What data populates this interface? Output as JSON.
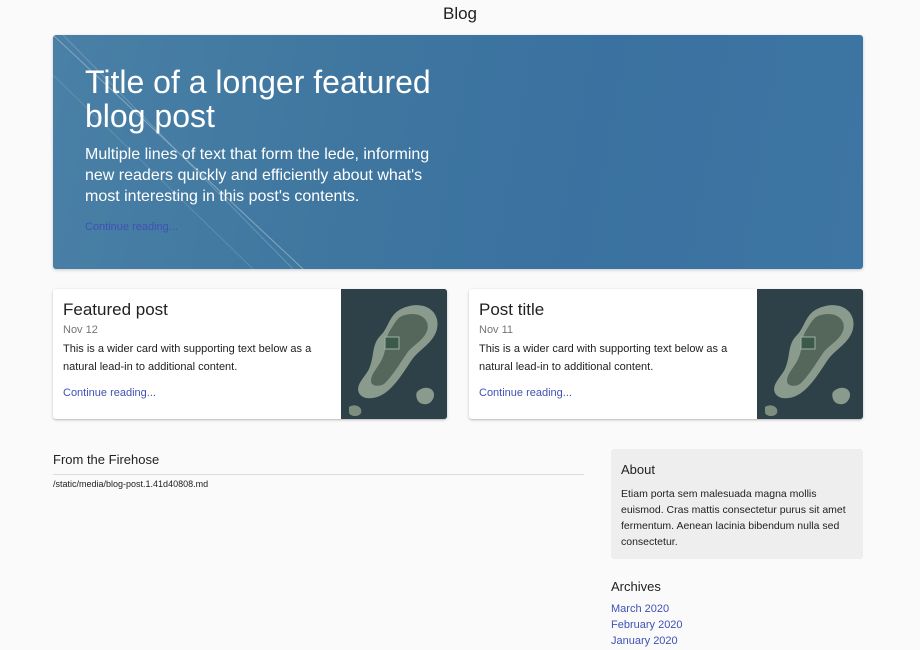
{
  "header": {
    "title": "Blog"
  },
  "hero": {
    "title": "Title of a longer featured blog post",
    "lede": "Multiple lines of text that form the lede, informing new readers quickly and efficiently about what's most interesting in this post's contents.",
    "link": "Continue reading..."
  },
  "cards": [
    {
      "title": "Featured post",
      "date": "Nov 12",
      "text": "This is a wider card with supporting text below as a natural lead-in to additional content.",
      "link": "Continue reading..."
    },
    {
      "title": "Post title",
      "date": "Nov 11",
      "text": "This is a wider card with supporting text below as a natural lead-in to additional content.",
      "link": "Continue reading..."
    }
  ],
  "main": {
    "section_title": "From the Firehose",
    "file": "/static/media/blog-post.1.41d40808.md"
  },
  "sidebar": {
    "about_title": "About",
    "about_text": "Etiam porta sem malesuada magna mollis euismod. Cras mattis consectetur purus sit amet fermentum. Aenean lacinia bibendum nulla sed consectetur.",
    "archives_title": "Archives",
    "archives": [
      "March 2020",
      "February 2020",
      "January 2020"
    ]
  },
  "colors": {
    "link": "#3f51b5",
    "hero_bg": "#3d75a3",
    "about_bg": "#eeeeee"
  }
}
